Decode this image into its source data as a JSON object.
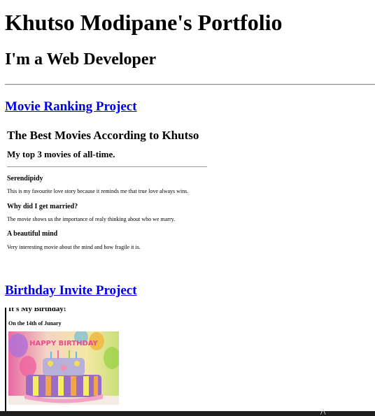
{
  "header": {
    "title": "Khutso Modipane's Portfolio",
    "subtitle": "I'm a Web Developer"
  },
  "projects": [
    {
      "label": "Movie Ranking Project"
    },
    {
      "label": "Birthday Invite Project"
    }
  ],
  "movie_page": {
    "title": "The Best Movies According to Khutso",
    "subtitle": "My top 3 movies of all-time.",
    "movies": [
      {
        "name": "Serendipidy",
        "description": "This is my favourite love story because it reminds me that true love always wins."
      },
      {
        "name": "Why did I get married?",
        "description": "The movie shows us the importance of realy thinking about who we marry."
      },
      {
        "name": "A beautiful mind",
        "description": "Very interesting movie about the mind and how fragile it is."
      }
    ]
  },
  "invite_page": {
    "title": "It's My Birthday!",
    "date": "On the 14th of Junary",
    "image_name": "birthday-cake-image",
    "cake_text": "HAPPY BIRTHDAY"
  },
  "colors": {
    "link": "#0000ee",
    "bottom_bar": "#1e1e1e"
  }
}
